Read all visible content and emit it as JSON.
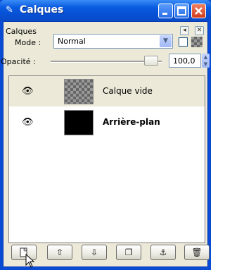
{
  "window": {
    "title": "Calques",
    "icon": "gimp-layers-icon"
  },
  "panel": {
    "header_label": "Calques",
    "mode_label": "Mode :",
    "mode_value": "Normal",
    "opacity_label": "Opacité :",
    "opacity_value": "100,0"
  },
  "layers": [
    {
      "name": "Calque vide",
      "visible": true,
      "thumbnail": "transparent",
      "selected": true
    },
    {
      "name": "Arrière-plan",
      "visible": true,
      "thumbnail": "black",
      "selected": false
    }
  ],
  "toolbar": {
    "buttons": [
      "new-layer",
      "raise-layer",
      "lower-layer",
      "duplicate-layer",
      "anchor-layer",
      "delete-layer"
    ]
  }
}
